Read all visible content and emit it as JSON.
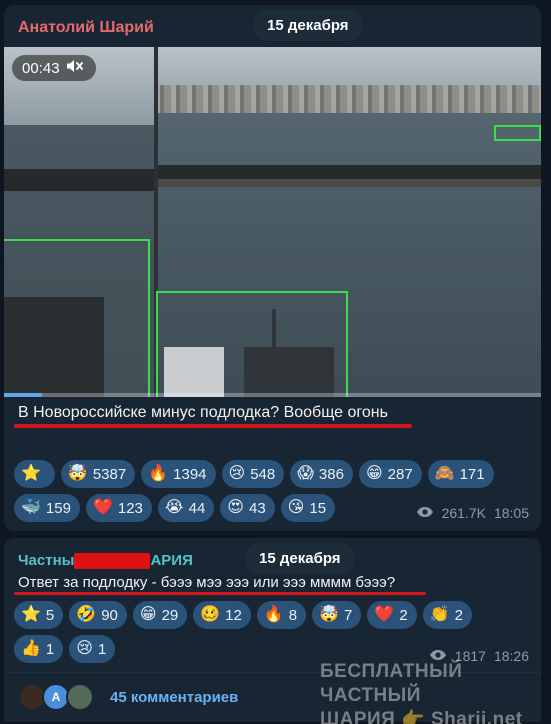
{
  "message1": {
    "author": "Анатолий Шарий",
    "date_pill": "15 декабря",
    "video_duration": "00:43",
    "video_progress": 0.07,
    "caption": "В Новороссийске минус подлодка? Вообще огонь",
    "reactions": [
      {
        "emoji": "⭐",
        "count": ""
      },
      {
        "emoji": "🤯",
        "count": "5387"
      },
      {
        "emoji": "🔥",
        "count": "1394"
      },
      {
        "emoji": "😢",
        "count": "548"
      },
      {
        "emoji": "😱",
        "count": "386"
      },
      {
        "emoji": "😁",
        "count": "287"
      },
      {
        "emoji": "🙈",
        "count": "171"
      },
      {
        "emoji": "🐳",
        "count": "159"
      },
      {
        "emoji": "❤️",
        "count": "123"
      },
      {
        "emoji": "😭",
        "count": "44"
      },
      {
        "emoji": "😍",
        "count": "43"
      },
      {
        "emoji": "😘",
        "count": "15"
      }
    ],
    "views": "261.7K",
    "time": "18:05"
  },
  "message2": {
    "author": "Частны",
    "author_suffix": "АРИЯ",
    "date_pill": "15 декабря",
    "text": "Ответ за подлодку - бэээ мээ эээ или эээ мммм бэээ?",
    "reactions": [
      {
        "emoji": "⭐",
        "count": "5"
      },
      {
        "emoji": "🤣",
        "count": "90"
      },
      {
        "emoji": "😁",
        "count": "29"
      },
      {
        "emoji": "🥴",
        "count": "12"
      },
      {
        "emoji": "🔥",
        "count": "8"
      },
      {
        "emoji": "🤯",
        "count": "7"
      },
      {
        "emoji": "❤️",
        "count": "2"
      },
      {
        "emoji": "👏",
        "count": "2"
      },
      {
        "emoji": "👍",
        "count": "1"
      },
      {
        "emoji": "😢",
        "count": "1"
      }
    ],
    "views": "1817",
    "time": "18:26",
    "comments_label": "45 комментариев",
    "avatar_letter": "A"
  },
  "watermark": {
    "line1": "БЕСПЛАТНЫЙ ЧАСТНЫЙ",
    "line2": "ШАРИЯ 👉 Sharij.net"
  },
  "colors": {
    "background": "#0e1621",
    "bubble": "#182533",
    "reaction_pill": "#2b5278",
    "author1": "#e46b6b",
    "author2": "#58c1c8",
    "link": "#6ab3f3",
    "annotation_red": "#d3151c",
    "detection_box": "#3ddc4a"
  },
  "icons": {
    "mute": "speaker-muted-icon",
    "views": "eye-icon"
  }
}
